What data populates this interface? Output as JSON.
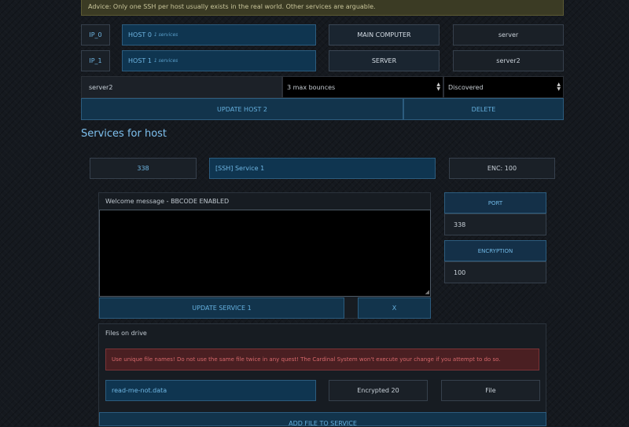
{
  "advice": "Advice: Only one SSH per host usually exists in the real world. Other services are arguable.",
  "hosts": [
    {
      "ip": "IP_0",
      "name": "HOST 0",
      "services": "1 services",
      "type_button": "MAIN COMPUTER",
      "hostname": "server"
    },
    {
      "ip": "IP_1",
      "name": "HOST 1",
      "services": "1 services",
      "type_button": "SERVER",
      "hostname": "server2"
    }
  ],
  "edit_host": {
    "name_value": "server2",
    "bounces_value": "3 max bounces",
    "state_value": "Discovered",
    "update_label": "UPDATE HOST 2",
    "delete_label": "DELETE"
  },
  "services_heading": "Services for host",
  "service": {
    "port": "338",
    "name": "[SSH] Service 1",
    "enc": "ENC: 100",
    "welcome_label": "Welcome message - BBCODE ENABLED",
    "welcome_text": "",
    "update_label": "UPDATE SERVICE 1",
    "x_label": "X",
    "port_label": "PORT",
    "port_value": "338",
    "encryption_label": "ENCRYPTION",
    "encryption_value": "100"
  },
  "files": {
    "heading": "Files on drive",
    "warning": "Use unique file names! Do not use the same file twice in any quest! The Cardinal System won't execute your change if you attempt to do so.",
    "file_name": "read-me-not.data",
    "file_enc": "Encrypted 20",
    "file_type": "File",
    "add_label": "ADD FILE TO SERVICE"
  },
  "colors": {
    "accent": "#6fb6e3",
    "warning": "#d6686b",
    "background": "#15191f"
  }
}
